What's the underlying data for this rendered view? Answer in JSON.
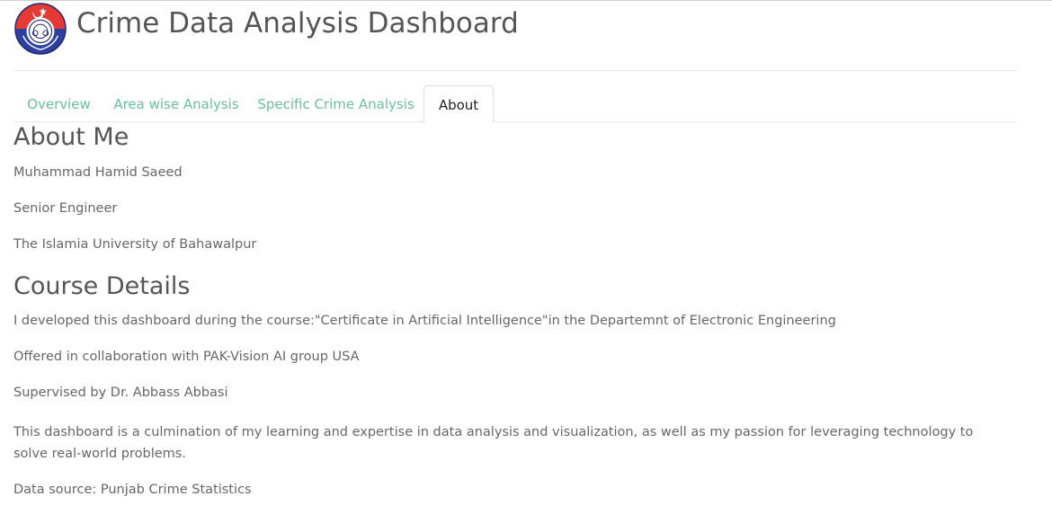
{
  "header": {
    "title": "Crime Data Analysis Dashboard",
    "logo": "punjab-police-emblem"
  },
  "tabs": [
    {
      "label": "Overview",
      "active": false
    },
    {
      "label": "Area wise Analysis",
      "active": false
    },
    {
      "label": "Specific Crime Analysis",
      "active": false
    },
    {
      "label": "About",
      "active": true
    }
  ],
  "about": {
    "heading": "About Me",
    "name": "Muhammad Hamid Saeed",
    "role": "Senior Engineer",
    "organization": "The Islamia University of Bahawalpur"
  },
  "course": {
    "heading": "Course Details",
    "line1": "I developed this dashboard during the course:\"Certificate in Artificial Intelligence\"in the Departemnt of Electronic Engineering",
    "line2": "Offered in collaboration with PAK-Vision AI group USA",
    "line3": "Supervised by Dr. Abbass Abbasi",
    "summary": "This dashboard is a culmination of my learning and expertise in data analysis and visualization, as well as my passion for leveraging technology to solve real-world problems.",
    "source": "Data source: Punjab Crime Statistics"
  },
  "colors": {
    "tab_link": "#6cbf9a",
    "tab_active": "#222222",
    "heading": "#555555",
    "body_text": "#666666"
  }
}
